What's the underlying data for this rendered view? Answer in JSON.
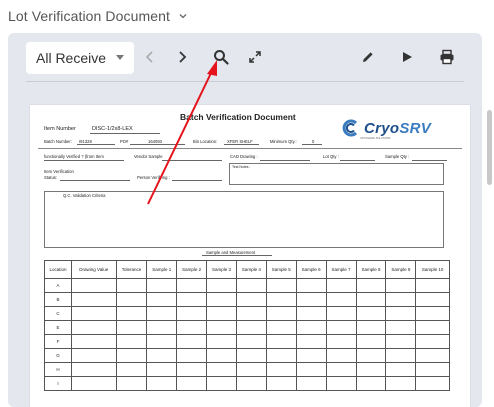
{
  "header": {
    "title": "Lot Verification Document"
  },
  "toolbar": {
    "receiver_select": "All Receive",
    "icons": [
      "chevron-left",
      "chevron-right",
      "search",
      "expand",
      "pencil",
      "play",
      "print"
    ]
  },
  "document": {
    "title": "Batch Verification Document",
    "item_number_label": "Item Number",
    "item_number_value": "DISC-1/2x8-LEX",
    "batch_number_label": "Batch Number:",
    "batch_number_value": "I91328",
    "po_label": "PO#",
    "po_value": "164083",
    "bin_location_label": "Bin Location:",
    "bin_location_value": "XFER SHELF",
    "min_qty_label": "Minimum Qty.:",
    "min_qty_value": "0",
    "func_verified_label": "functionally Verified ? (from Item",
    "vendor_sample_label": "Vendor Sample",
    "cad_drawing_label": "CAD Drawing :",
    "lot_qty_label": "Lot Qty :",
    "sample_qty_label": "Sample Qty :",
    "item_verification_label": "Item Verification",
    "status_label": "Status:",
    "person_verifying_label": "Person Verifying :",
    "test_notes_label": "Test Notes :",
    "qc_criteria_label": "Q.C. Validation Criteria",
    "sample_measurement_label": "Sample and Measurement",
    "logo": {
      "part1": "Cryo",
      "part2": "SRV",
      "tagline": "CRYOGENIC SOLUTIONS"
    }
  },
  "table": {
    "headers": [
      "Location",
      "Drawing Value",
      "Tolerance",
      "Sample 1",
      "Sample 2",
      "Sample 3",
      "Sample 4",
      "Sample 5",
      "Sample 6",
      "Sample 7",
      "Sample 8",
      "Sample 9",
      "Sample 10"
    ],
    "rows": [
      "A",
      "B",
      "C",
      "E",
      "F",
      "G",
      "H",
      "I"
    ]
  },
  "colors": {
    "viewer_bg": "#e4e7ee",
    "annotation_arrow": "#e5141c",
    "logo_blue": "#1d4f8b"
  }
}
